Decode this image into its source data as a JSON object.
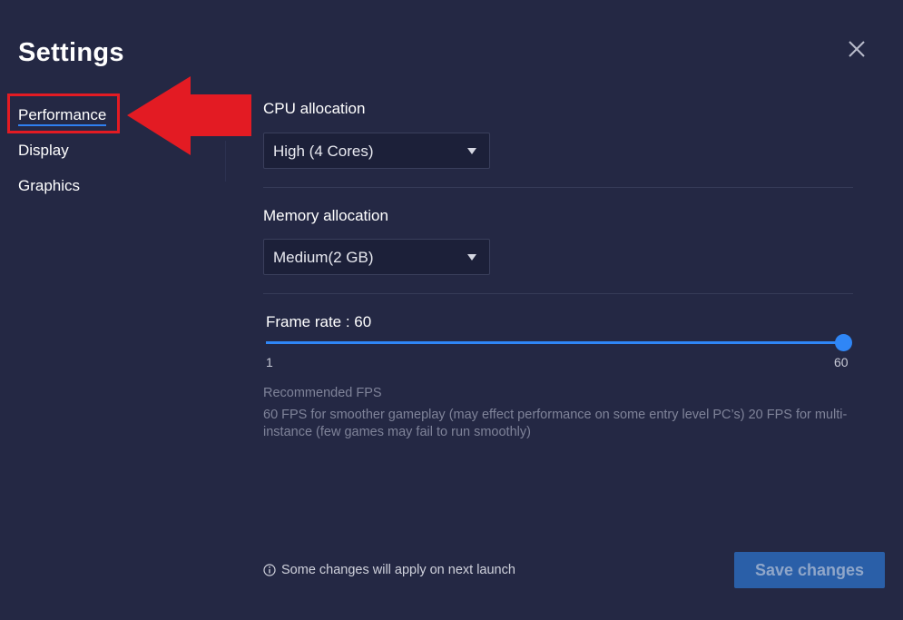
{
  "header": {
    "title": "Settings"
  },
  "sidebar": {
    "items": [
      {
        "label": "Performance",
        "active": true
      },
      {
        "label": "Display",
        "active": false
      },
      {
        "label": "Graphics",
        "active": false
      }
    ]
  },
  "cpu": {
    "label": "CPU allocation",
    "selected": "High (4 Cores)"
  },
  "memory": {
    "label": "Memory allocation",
    "selected": "Medium(2 GB)"
  },
  "frame_rate": {
    "label": "Frame rate : 60",
    "value": 60,
    "min": 1,
    "max": 60,
    "min_label": "1",
    "max_label": "60"
  },
  "recommended": {
    "title": "Recommended FPS",
    "description": "60 FPS for smoother gameplay (may effect performance on some entry level PC’s) 20 FPS for multi-instance (few games may fail to run smoothly)"
  },
  "footer": {
    "notice": "Some changes will apply on next launch",
    "save_label": "Save changes"
  },
  "colors": {
    "background": "#242844",
    "accent": "#2f86f6",
    "annotation_red": "#e31b23",
    "save_button_bg": "#2a5fa8"
  },
  "icons": {
    "close": "close-icon",
    "caret": "chevron-down-icon",
    "info": "info-icon",
    "annotation": "arrow-left-icon"
  }
}
